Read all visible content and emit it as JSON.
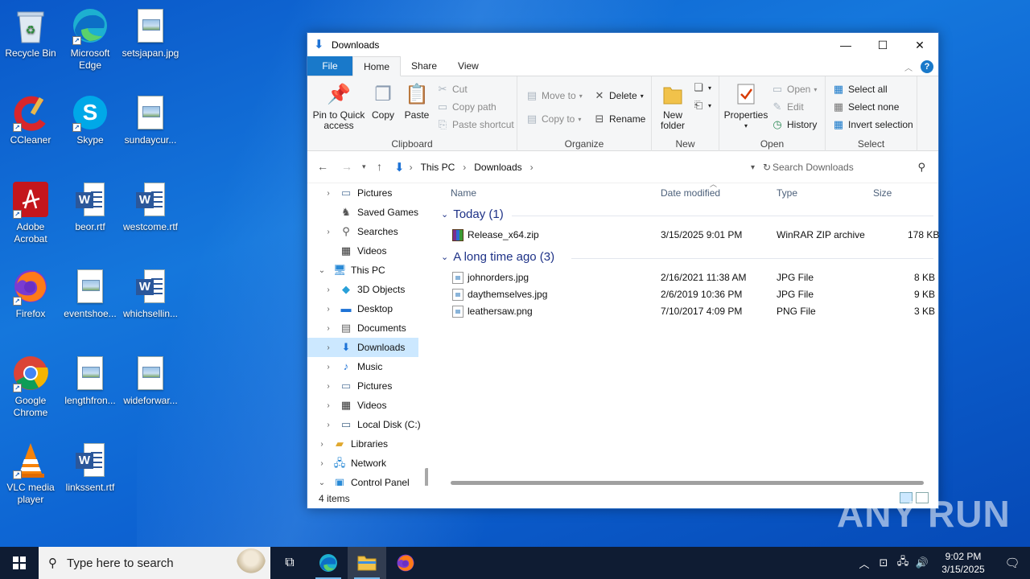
{
  "desktop": {
    "icons": [
      {
        "label": "Recycle Bin"
      },
      {
        "label": "Microsoft Edge"
      },
      {
        "label": "setsjapan.jpg"
      },
      {
        "label": "CCleaner"
      },
      {
        "label": "Skype"
      },
      {
        "label": "sundaycur..."
      },
      {
        "label": "Adobe Acrobat"
      },
      {
        "label": "beor.rtf"
      },
      {
        "label": "westcome.rtf"
      },
      {
        "label": "Firefox"
      },
      {
        "label": "eventshoe..."
      },
      {
        "label": "whichsellin..."
      },
      {
        "label": "Google Chrome"
      },
      {
        "label": "lengthfron..."
      },
      {
        "label": "wideforwar..."
      },
      {
        "label": "VLC media player"
      },
      {
        "label": "linkssent.rtf"
      }
    ]
  },
  "window": {
    "title": "Downloads",
    "controls": {
      "minimize": "—",
      "maximize": "☐",
      "close": "✕"
    },
    "tabs": [
      "File",
      "Home",
      "Share",
      "View"
    ],
    "ribbon": {
      "clipboard": {
        "name": "Clipboard",
        "pin": "Pin to Quick access",
        "copy": "Copy",
        "paste": "Paste",
        "cut": "Cut",
        "copy_path": "Copy path",
        "paste_shortcut": "Paste shortcut"
      },
      "organize": {
        "name": "Organize",
        "move_to": "Move to",
        "copy_to": "Copy to",
        "delete": "Delete",
        "rename": "Rename"
      },
      "new": {
        "name": "New",
        "new_folder": "New folder"
      },
      "open": {
        "name": "Open",
        "properties": "Properties",
        "open": "Open",
        "edit": "Edit",
        "history": "History"
      },
      "select": {
        "name": "Select",
        "select_all": "Select all",
        "select_none": "Select none",
        "invert": "Invert selection"
      }
    },
    "address": {
      "crumbs": [
        "This PC",
        "Downloads"
      ],
      "search_placeholder": "Search Downloads"
    },
    "nav": [
      {
        "label": "Pictures"
      },
      {
        "label": "Saved Games"
      },
      {
        "label": "Searches"
      },
      {
        "label": "Videos"
      },
      {
        "label": "This PC"
      },
      {
        "label": "3D Objects"
      },
      {
        "label": "Desktop"
      },
      {
        "label": "Documents"
      },
      {
        "label": "Downloads"
      },
      {
        "label": "Music"
      },
      {
        "label": "Pictures"
      },
      {
        "label": "Videos"
      },
      {
        "label": "Local Disk (C:)"
      },
      {
        "label": "Libraries"
      },
      {
        "label": "Network"
      },
      {
        "label": "Control Panel"
      }
    ],
    "columns": {
      "name": "Name",
      "date": "Date modified",
      "type": "Type",
      "size": "Size"
    },
    "groups": [
      {
        "title": "Today (1)",
        "files": [
          {
            "name": "Release_x64.zip",
            "date": "3/15/2025 9:01 PM",
            "type": "WinRAR ZIP archive",
            "size": "178 KB"
          }
        ]
      },
      {
        "title": "A long time ago (3)",
        "files": [
          {
            "name": "johnorders.jpg",
            "date": "2/16/2021 11:38 AM",
            "type": "JPG File",
            "size": "8 KB"
          },
          {
            "name": "daythemselves.jpg",
            "date": "2/6/2019 10:36 PM",
            "type": "JPG File",
            "size": "9 KB"
          },
          {
            "name": "leathersaw.png",
            "date": "7/10/2017 4:09 PM",
            "type": "PNG File",
            "size": "3 KB"
          }
        ]
      }
    ],
    "status": "4 items"
  },
  "taskbar": {
    "search_placeholder": "Type here to search",
    "time": "9:02 PM",
    "date": "3/15/2025"
  },
  "watermark": "ANY RUN"
}
